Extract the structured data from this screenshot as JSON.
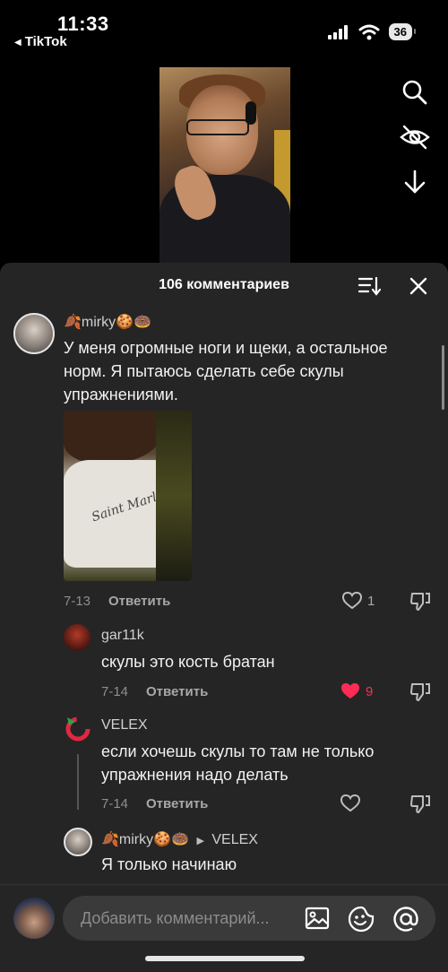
{
  "status": {
    "time": "11:33",
    "back_app": "TikTok",
    "battery": "36"
  },
  "comments_header": {
    "title": "106 комментариев"
  },
  "comments": [
    {
      "username": "🍂mirky🍪🍩",
      "text": "У меня огромные ноги и щеки, а остальное норм. Я пытаюсь сделать себе скулы упражнениями.",
      "photo_text": "Saint Marl",
      "date": "7-13",
      "reply_label": "Ответить",
      "likes": "1"
    },
    {
      "username": "gar11k",
      "text": "скулы это кость братан",
      "date": "7-14",
      "reply_label": "Ответить",
      "likes": "9",
      "liked": true,
      "like_color": "#fe2c55"
    },
    {
      "username": "VELEX",
      "text": "если хочешь скулы то там не только упражнения надо делать",
      "date": "7-14",
      "reply_label": "Ответить"
    },
    {
      "username": "🍂mirky🍪🍩",
      "reply_to": "VELEX",
      "text": "Я только начинаю"
    }
  ],
  "input": {
    "placeholder": "Добавить комментарий..."
  },
  "icons": [
    "search-icon",
    "eye-off-icon",
    "download-icon",
    "sort-icon",
    "close-icon",
    "heart-icon",
    "dislike-icon",
    "image-icon",
    "emoji-icon",
    "mention-icon"
  ]
}
